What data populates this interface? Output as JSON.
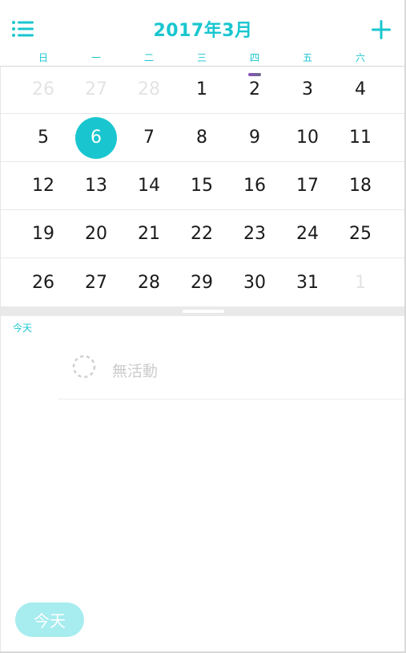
{
  "header": {
    "title": "2017年3月",
    "menu_icon": "list-menu-icon",
    "add_icon": "plus-icon"
  },
  "weekdays": [
    "日",
    "一",
    "二",
    "三",
    "四",
    "五",
    "六"
  ],
  "weeks": [
    [
      {
        "label": "26",
        "other_month": true
      },
      {
        "label": "27",
        "other_month": true
      },
      {
        "label": "28",
        "other_month": true
      },
      {
        "label": "1"
      },
      {
        "label": "2",
        "has_event": true
      },
      {
        "label": "3"
      },
      {
        "label": "4"
      }
    ],
    [
      {
        "label": "5"
      },
      {
        "label": "6",
        "today": true
      },
      {
        "label": "7"
      },
      {
        "label": "8"
      },
      {
        "label": "9"
      },
      {
        "label": "10"
      },
      {
        "label": "11"
      }
    ],
    [
      {
        "label": "12"
      },
      {
        "label": "13"
      },
      {
        "label": "14"
      },
      {
        "label": "15"
      },
      {
        "label": "16"
      },
      {
        "label": "17"
      },
      {
        "label": "18"
      }
    ],
    [
      {
        "label": "19"
      },
      {
        "label": "20"
      },
      {
        "label": "21"
      },
      {
        "label": "22"
      },
      {
        "label": "23"
      },
      {
        "label": "24"
      },
      {
        "label": "25"
      }
    ],
    [
      {
        "label": "26"
      },
      {
        "label": "27"
      },
      {
        "label": "28"
      },
      {
        "label": "29"
      },
      {
        "label": "30"
      },
      {
        "label": "31"
      },
      {
        "label": "1",
        "other_month": true
      }
    ]
  ],
  "agenda": {
    "section_label": "今天",
    "empty_text": "無活動",
    "empty_icon": "dashed-circle-icon"
  },
  "today_button": {
    "label": "今天"
  },
  "colors": {
    "accent": "#19c6cf",
    "today_button_bg": "#a7ecef",
    "muted_day": "#e3e3e3",
    "event_marker": "#8a4fb8"
  }
}
